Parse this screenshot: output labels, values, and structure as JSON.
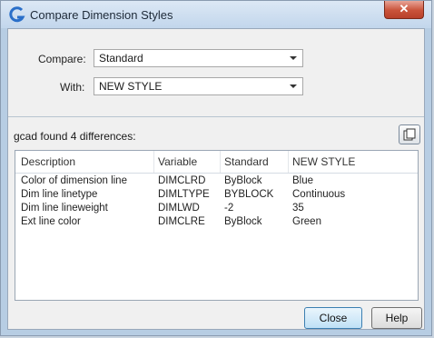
{
  "window": {
    "title": "Compare Dimension Styles",
    "close_glyph": "✕"
  },
  "compare": {
    "label": "Compare:",
    "value": "Standard"
  },
  "with": {
    "label": "With:",
    "value": "NEW STYLE"
  },
  "results": {
    "summary": "gcad found 4 differences:"
  },
  "table": {
    "headers": [
      "Description",
      "Variable",
      "Standard",
      "NEW STYLE"
    ],
    "rows": [
      [
        "Color of dimension line",
        "DIMCLRD",
        "ByBlock",
        "Blue"
      ],
      [
        "Dim line linetype",
        "DIMLTYPE",
        "BYBLOCK",
        "Continuous"
      ],
      [
        "Dim line lineweight",
        "DIMLWD",
        "-2",
        "35"
      ],
      [
        "Ext line color",
        "DIMCLRE",
        "ByBlock",
        "Green"
      ]
    ]
  },
  "buttons": {
    "close": "Close",
    "help": "Help"
  },
  "icons": {
    "app": "gcad-logo-icon",
    "copy": "copy-to-clipboard-icon",
    "dropdown": "chevron-down-icon"
  }
}
